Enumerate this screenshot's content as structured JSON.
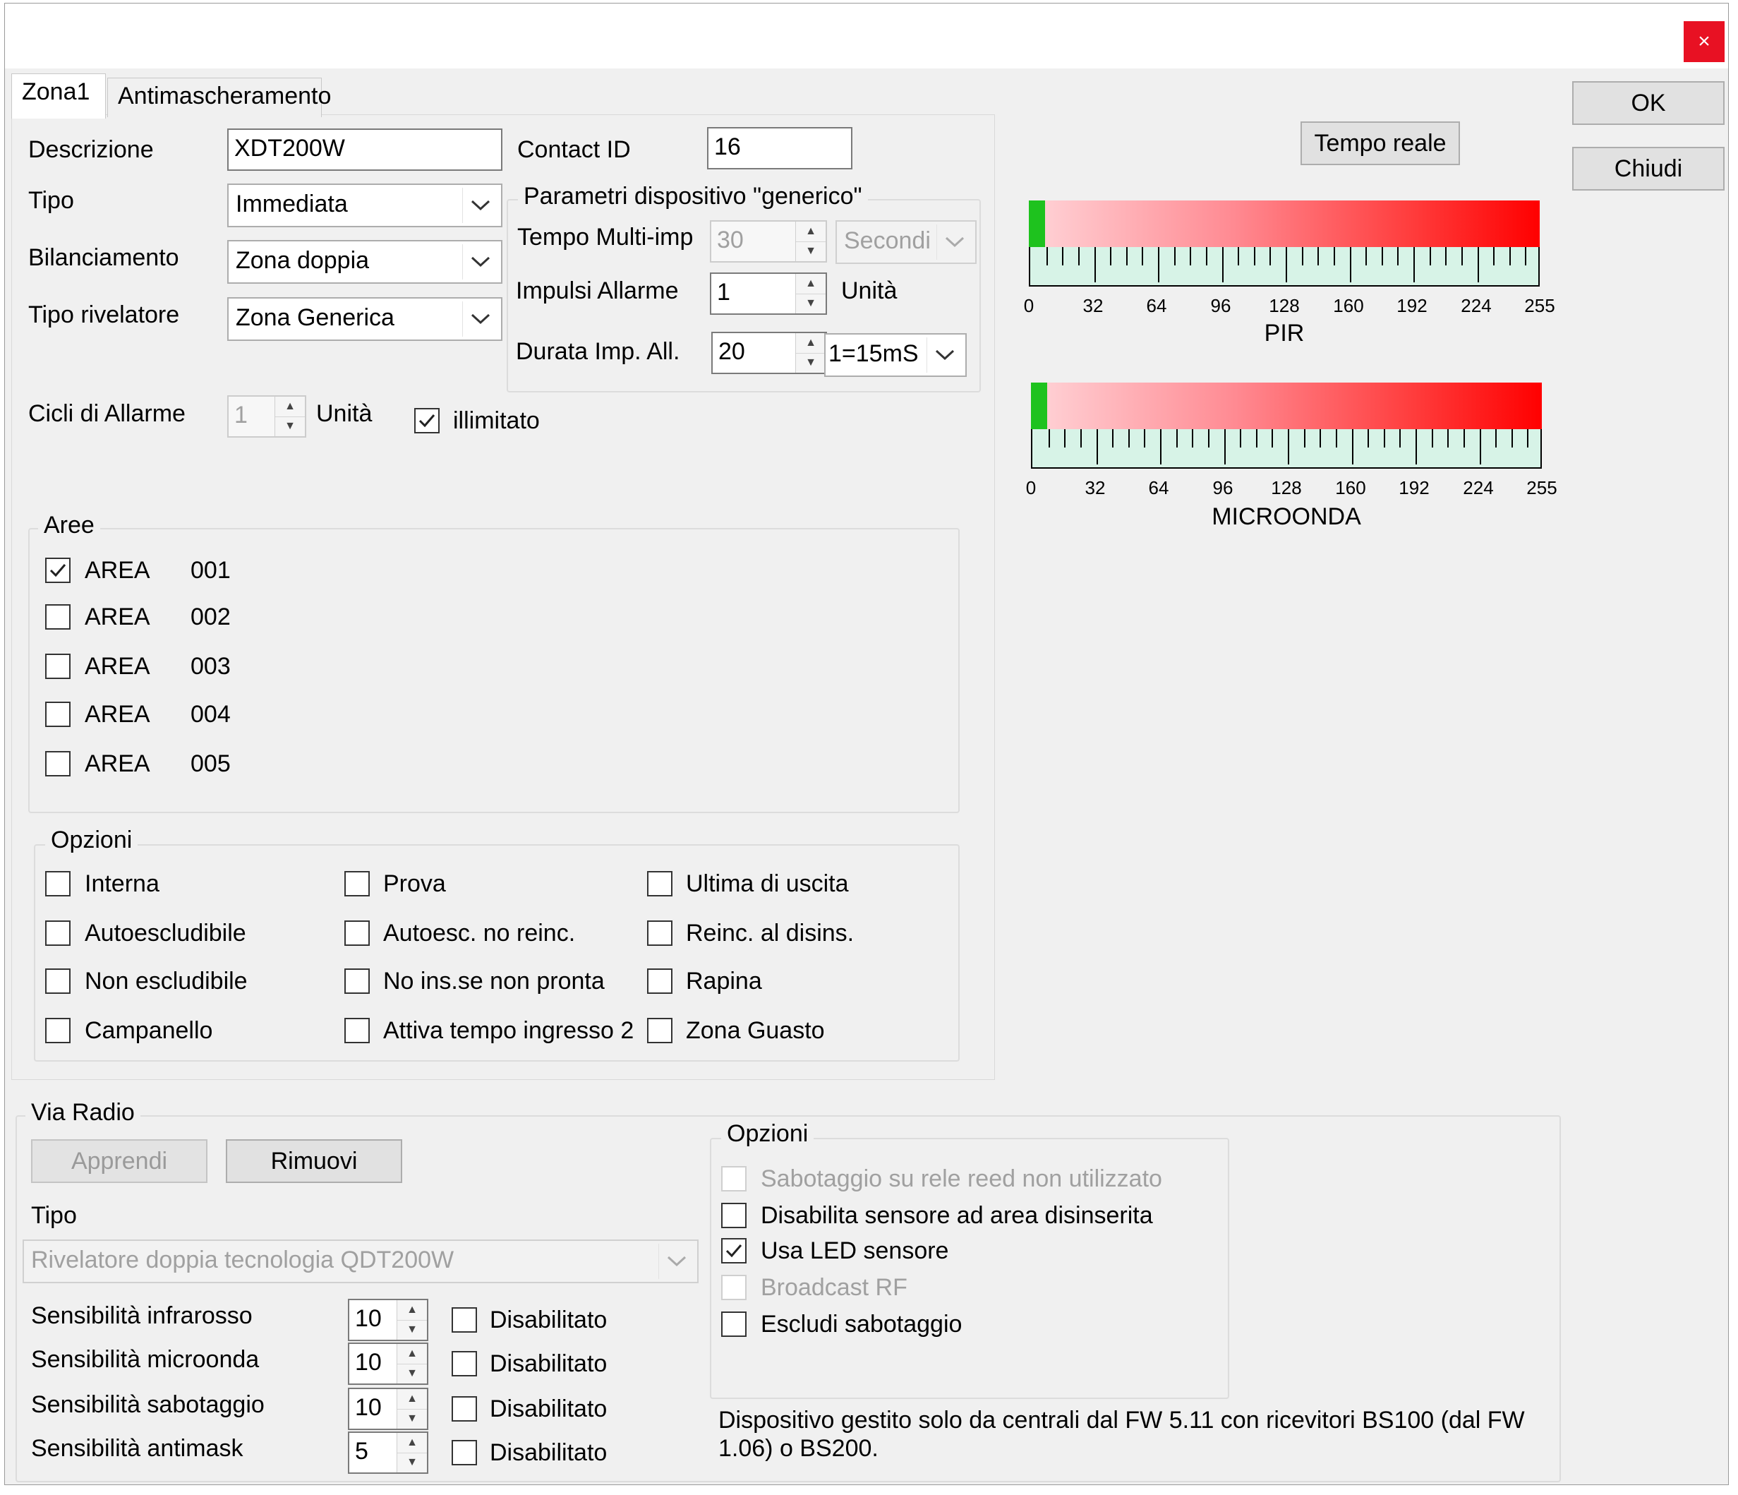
{
  "window": {
    "close_label": "×"
  },
  "tabs": [
    {
      "label": "Zona1"
    },
    {
      "label": "Antimascheramento"
    }
  ],
  "buttons": {
    "ok": "OK",
    "close": "Chiudi",
    "realtime": "Tempo reale"
  },
  "zone": {
    "descrizione": {
      "label": "Descrizione",
      "value": "XDT200W"
    },
    "tipo": {
      "label": "Tipo",
      "value": "Immediata"
    },
    "bilanciamento": {
      "label": "Bilanciamento",
      "value": "Zona doppia"
    },
    "tipo_rivelatore": {
      "label": "Tipo rivelatore",
      "value": "Zona Generica"
    },
    "contact_id": {
      "label": "Contact ID",
      "value": "16"
    },
    "cicli": {
      "label": "Cicli di Allarme",
      "value": "1",
      "unit": "Unità"
    },
    "illimitato": {
      "label": "illimitato",
      "checked": true
    }
  },
  "generic_params": {
    "title": "Parametri dispositivo \"generico\"",
    "tempo_multi": {
      "label": "Tempo Multi-imp",
      "value": "30",
      "unit": "Secondi"
    },
    "impulsi": {
      "label": "Impulsi Allarme",
      "value": "1",
      "unit": "Unità"
    },
    "durata": {
      "label": "Durata Imp. All.",
      "value": "20",
      "unit": "1=15mS"
    }
  },
  "aree": {
    "title": "Aree",
    "items": [
      {
        "label": "AREA",
        "code": "001",
        "checked": true
      },
      {
        "label": "AREA",
        "code": "002",
        "checked": false
      },
      {
        "label": "AREA",
        "code": "003",
        "checked": false
      },
      {
        "label": "AREA",
        "code": "004",
        "checked": false
      },
      {
        "label": "AREA",
        "code": "005",
        "checked": false
      }
    ]
  },
  "opzioni": {
    "title": "Opzioni",
    "col1": [
      "Interna",
      "Autoescludibile",
      "Non escludibile",
      "Campanello"
    ],
    "col2": [
      "Prova",
      "Autoesc. no reinc.",
      "No ins.se non pronta",
      "Attiva tempo ingresso 2"
    ],
    "col3": [
      "Ultima di uscita",
      "Reinc. al disins.",
      "Rapina",
      "Zona Guasto"
    ]
  },
  "gauges": {
    "ticks": [
      "0",
      "32",
      "64",
      "96",
      "128",
      "160",
      "192",
      "224",
      "255"
    ],
    "pir": {
      "title": "PIR",
      "value": 8,
      "max": 255
    },
    "micro": {
      "title": "MICROONDA",
      "value": 8,
      "max": 255
    }
  },
  "via_radio": {
    "title": "Via Radio",
    "apprendi": "Apprendi",
    "rimuovi": "Rimuovi",
    "tipo_label": "Tipo",
    "tipo_value": "Rivelatore doppia tecnologia QDT200W",
    "sens": [
      {
        "label": "Sensibilità infrarosso",
        "value": "10",
        "disabled_label": "Disabilitato"
      },
      {
        "label": "Sensibilità microonda",
        "value": "10",
        "disabled_label": "Disabilitato"
      },
      {
        "label": "Sensibilità sabotaggio",
        "value": "10",
        "disabled_label": "Disabilitato"
      },
      {
        "label": "Sensibilità antimask",
        "value": "5",
        "disabled_label": "Disabilitato"
      }
    ],
    "opzioni_title": "Opzioni",
    "opzioni": [
      {
        "label": "Sabotaggio su rele reed non utilizzato",
        "checked": false,
        "enabled": false
      },
      {
        "label": "Disabilita sensore ad area disinserita",
        "checked": false,
        "enabled": true
      },
      {
        "label": "Usa LED sensore",
        "checked": true,
        "enabled": true
      },
      {
        "label": "Broadcast RF",
        "checked": false,
        "enabled": false
      },
      {
        "label": "Escludi sabotaggio",
        "checked": false,
        "enabled": true
      }
    ],
    "note": "Dispositivo gestito solo da centrali dal FW 5.11 con ricevitori BS100 (dal FW 1.06) o BS200."
  }
}
